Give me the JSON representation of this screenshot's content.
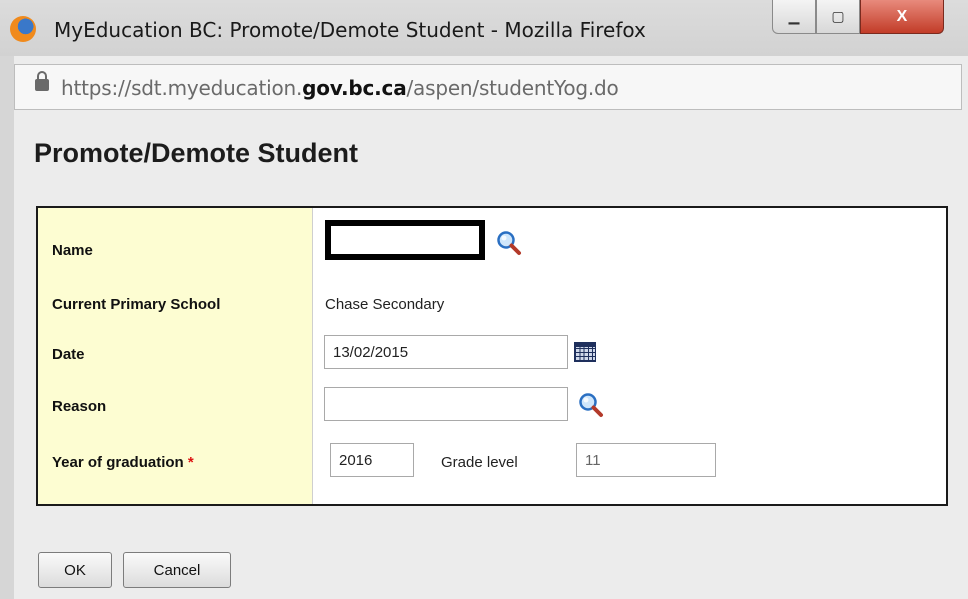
{
  "window": {
    "title": "MyEducation BC: Promote/Demote Student - Mozilla Firefox",
    "url_prefix": "https://sdt.myeducation.",
    "url_domain": "gov.bc.ca",
    "url_path": "/aspen/studentYog.do",
    "minimize_label": "▁",
    "maximize_label": "▢",
    "close_label": "X"
  },
  "page": {
    "title": "Promote/Demote Student"
  },
  "form": {
    "name_label": "Name",
    "school_label": "Current Primary School",
    "school_value": "Chase Secondary",
    "date_label": "Date",
    "date_value": "13/02/2015",
    "reason_label": "Reason",
    "reason_value": "",
    "yog_label": "Year of graduation",
    "required_mark": "*",
    "yog_value": "2016",
    "grade_label": "Grade level",
    "grade_value": "11"
  },
  "buttons": {
    "ok": "OK",
    "cancel": "Cancel"
  },
  "icons": {
    "browser": "firefox-icon",
    "lock": "lock-icon",
    "name_lookup": "magnifier-icon",
    "date_picker": "calendar-icon",
    "reason_lookup": "magnifier-icon"
  },
  "colors": {
    "label_column_bg": "#fdfdd2",
    "required": "#dd1111",
    "close_button": "#c23c28"
  }
}
